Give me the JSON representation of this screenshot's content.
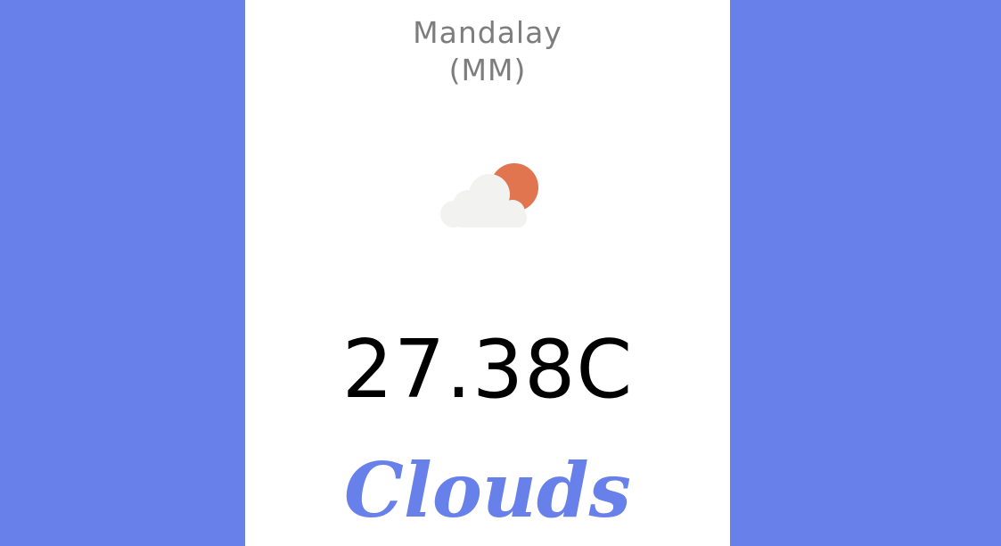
{
  "location": {
    "city": "Mandalay",
    "country": "(MM)"
  },
  "weather": {
    "icon": "sun-behind-cloud-icon",
    "temperature": "27.38C",
    "condition": "Clouds"
  },
  "colors": {
    "background": "#6780ea",
    "card": "#ffffff",
    "condition_text": "#6780ea",
    "city_text": "#7d7d7d",
    "sun": "#e07550",
    "cloud": "#f2f2f0"
  }
}
